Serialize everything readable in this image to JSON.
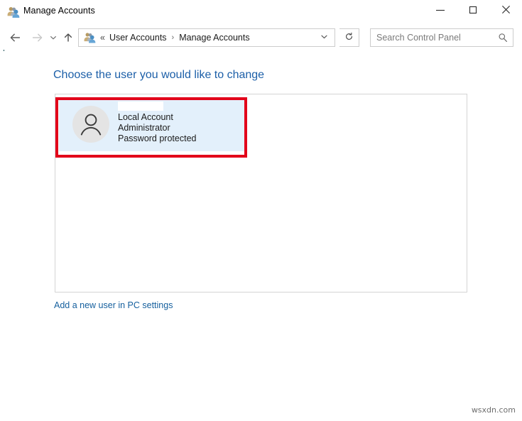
{
  "window": {
    "title": "Manage Accounts",
    "title_icon": "user-accounts-icon",
    "caption": {
      "minimize_label": "Minimize",
      "maximize_label": "Maximize",
      "close_label": "Close"
    }
  },
  "navbar": {
    "back_label": "Back",
    "forward_label": "Forward",
    "recent_label": "Recent locations",
    "up_label": "Up one level",
    "breadcrumb": {
      "icon": "user-accounts-icon",
      "overflow": "«",
      "separator": "›",
      "items": [
        {
          "label": "User Accounts"
        },
        {
          "label": "Manage Accounts"
        }
      ],
      "dropdown_label": "Previous locations"
    },
    "refresh_label": "Refresh",
    "search": {
      "value": "",
      "placeholder": "Search Control Panel",
      "icon": "search-icon"
    }
  },
  "content": {
    "heading": "Choose the user you would like to change",
    "accounts": [
      {
        "name": "",
        "type": "Local Account",
        "role": "Administrator",
        "password_status": "Password protected",
        "avatar": "default-user-avatar",
        "selected": true,
        "annotated": true
      }
    ],
    "add_user_link": "Add a new user in PC settings"
  },
  "watermark": "wsxdn.com",
  "colors": {
    "heading_blue": "#1c5fa8",
    "link_blue": "#16609e",
    "annotation_red": "#e2001a",
    "row_selected_bg": "#e3f0fb",
    "panel_border": "#d4d4d4",
    "window_edge": "#1d4f57"
  }
}
